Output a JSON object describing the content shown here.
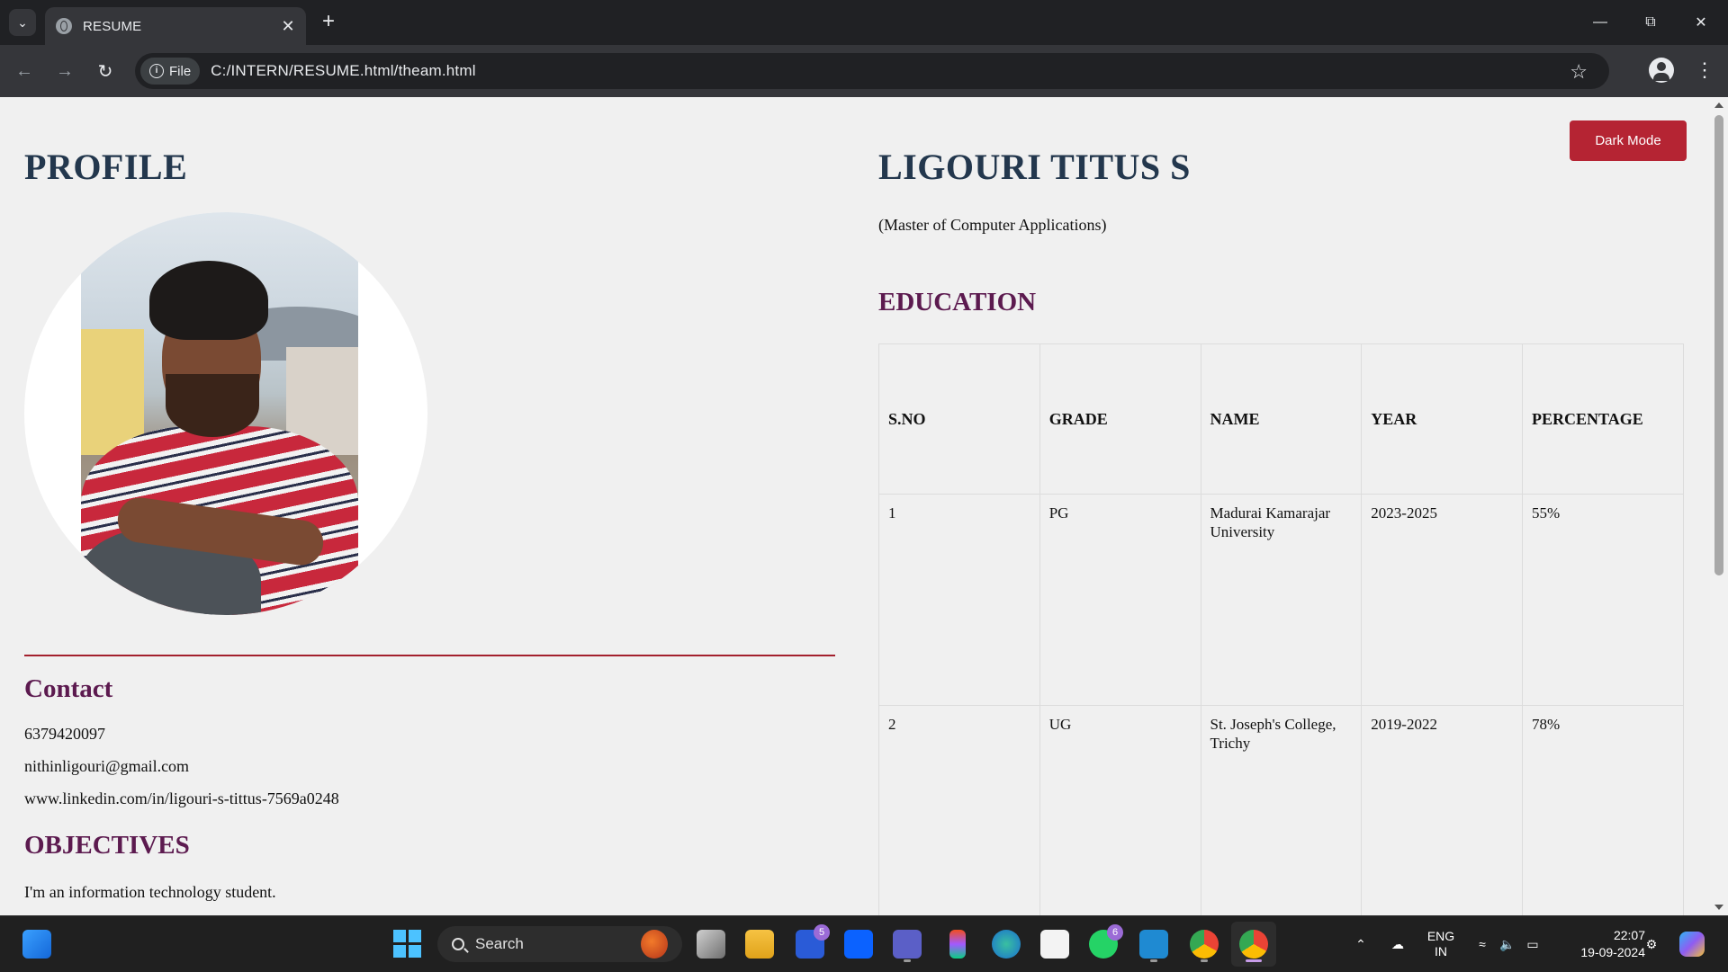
{
  "browser": {
    "tab_title": "RESUME",
    "url_chip": "File",
    "url": "C:/INTERN/RESUME.html/theam.html"
  },
  "page": {
    "profile_heading": "PROFILE",
    "name": "LIGOURI TITUS S",
    "degree": "(Master of Computer Applications)",
    "dark_mode_label": "Dark Mode",
    "contact_heading": "Contact",
    "contact": {
      "phone": "6379420097",
      "email": "nithinligouri@gmail.com",
      "linkedin": "www.linkedin.com/in/ligouri-s-tittus-7569a0248"
    },
    "objectives_heading": "OBJECTIVES",
    "objective_text": "I'm an information technology student.",
    "education_heading": "EDUCATION",
    "education_table": {
      "headers": [
        "S.NO",
        "GRADE",
        "NAME",
        "YEAR",
        "PERCENTAGE"
      ],
      "rows": [
        [
          "1",
          "PG",
          "Madurai Kamarajar University",
          "2023-2025",
          "55%"
        ],
        [
          "2",
          "UG",
          "St. Joseph's College, Trichy",
          "2019-2022",
          "78%"
        ]
      ]
    }
  },
  "taskbar": {
    "search_label": "Search",
    "badges": {
      "app_l": "5",
      "whatsapp": "6"
    },
    "lang_top": "ENG",
    "lang_bottom": "IN",
    "time": "22:07",
    "date": "19-09-2024"
  },
  "colors": {
    "heading_navy": "#23374d",
    "section_purple": "#5c1a4f",
    "accent_red": "#b52433",
    "page_bg": "#f0f0f0"
  }
}
